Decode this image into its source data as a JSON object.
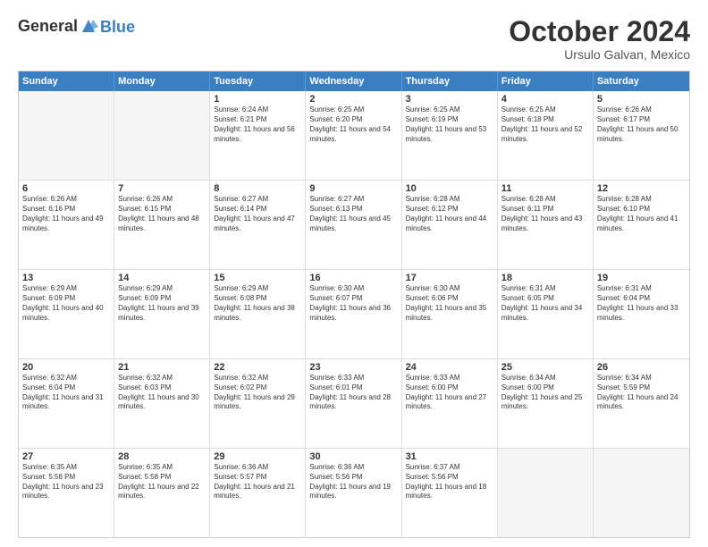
{
  "header": {
    "logo_line1": "General",
    "logo_line2": "Blue",
    "month": "October 2024",
    "location": "Ursulo Galvan, Mexico"
  },
  "weekdays": [
    "Sunday",
    "Monday",
    "Tuesday",
    "Wednesday",
    "Thursday",
    "Friday",
    "Saturday"
  ],
  "rows": [
    [
      {
        "day": "",
        "text": "",
        "empty": true
      },
      {
        "day": "",
        "text": "",
        "empty": true
      },
      {
        "day": "1",
        "text": "Sunrise: 6:24 AM\nSunset: 6:21 PM\nDaylight: 11 hours and 56 minutes.",
        "empty": false
      },
      {
        "day": "2",
        "text": "Sunrise: 6:25 AM\nSunset: 6:20 PM\nDaylight: 11 hours and 54 minutes.",
        "empty": false
      },
      {
        "day": "3",
        "text": "Sunrise: 6:25 AM\nSunset: 6:19 PM\nDaylight: 11 hours and 53 minutes.",
        "empty": false
      },
      {
        "day": "4",
        "text": "Sunrise: 6:25 AM\nSunset: 6:18 PM\nDaylight: 11 hours and 52 minutes.",
        "empty": false
      },
      {
        "day": "5",
        "text": "Sunrise: 6:26 AM\nSunset: 6:17 PM\nDaylight: 11 hours and 50 minutes.",
        "empty": false
      }
    ],
    [
      {
        "day": "6",
        "text": "Sunrise: 6:26 AM\nSunset: 6:16 PM\nDaylight: 11 hours and 49 minutes.",
        "empty": false
      },
      {
        "day": "7",
        "text": "Sunrise: 6:26 AM\nSunset: 6:15 PM\nDaylight: 11 hours and 48 minutes.",
        "empty": false
      },
      {
        "day": "8",
        "text": "Sunrise: 6:27 AM\nSunset: 6:14 PM\nDaylight: 11 hours and 47 minutes.",
        "empty": false
      },
      {
        "day": "9",
        "text": "Sunrise: 6:27 AM\nSunset: 6:13 PM\nDaylight: 11 hours and 45 minutes.",
        "empty": false
      },
      {
        "day": "10",
        "text": "Sunrise: 6:28 AM\nSunset: 6:12 PM\nDaylight: 11 hours and 44 minutes.",
        "empty": false
      },
      {
        "day": "11",
        "text": "Sunrise: 6:28 AM\nSunset: 6:11 PM\nDaylight: 11 hours and 43 minutes.",
        "empty": false
      },
      {
        "day": "12",
        "text": "Sunrise: 6:28 AM\nSunset: 6:10 PM\nDaylight: 11 hours and 41 minutes.",
        "empty": false
      }
    ],
    [
      {
        "day": "13",
        "text": "Sunrise: 6:29 AM\nSunset: 6:09 PM\nDaylight: 11 hours and 40 minutes.",
        "empty": false
      },
      {
        "day": "14",
        "text": "Sunrise: 6:29 AM\nSunset: 6:09 PM\nDaylight: 11 hours and 39 minutes.",
        "empty": false
      },
      {
        "day": "15",
        "text": "Sunrise: 6:29 AM\nSunset: 6:08 PM\nDaylight: 11 hours and 38 minutes.",
        "empty": false
      },
      {
        "day": "16",
        "text": "Sunrise: 6:30 AM\nSunset: 6:07 PM\nDaylight: 11 hours and 36 minutes.",
        "empty": false
      },
      {
        "day": "17",
        "text": "Sunrise: 6:30 AM\nSunset: 6:06 PM\nDaylight: 11 hours and 35 minutes.",
        "empty": false
      },
      {
        "day": "18",
        "text": "Sunrise: 6:31 AM\nSunset: 6:05 PM\nDaylight: 11 hours and 34 minutes.",
        "empty": false
      },
      {
        "day": "19",
        "text": "Sunrise: 6:31 AM\nSunset: 6:04 PM\nDaylight: 11 hours and 33 minutes.",
        "empty": false
      }
    ],
    [
      {
        "day": "20",
        "text": "Sunrise: 6:32 AM\nSunset: 6:04 PM\nDaylight: 11 hours and 31 minutes.",
        "empty": false
      },
      {
        "day": "21",
        "text": "Sunrise: 6:32 AM\nSunset: 6:03 PM\nDaylight: 11 hours and 30 minutes.",
        "empty": false
      },
      {
        "day": "22",
        "text": "Sunrise: 6:32 AM\nSunset: 6:02 PM\nDaylight: 11 hours and 29 minutes.",
        "empty": false
      },
      {
        "day": "23",
        "text": "Sunrise: 6:33 AM\nSunset: 6:01 PM\nDaylight: 11 hours and 28 minutes.",
        "empty": false
      },
      {
        "day": "24",
        "text": "Sunrise: 6:33 AM\nSunset: 6:00 PM\nDaylight: 11 hours and 27 minutes.",
        "empty": false
      },
      {
        "day": "25",
        "text": "Sunrise: 6:34 AM\nSunset: 6:00 PM\nDaylight: 11 hours and 25 minutes.",
        "empty": false
      },
      {
        "day": "26",
        "text": "Sunrise: 6:34 AM\nSunset: 5:59 PM\nDaylight: 11 hours and 24 minutes.",
        "empty": false
      }
    ],
    [
      {
        "day": "27",
        "text": "Sunrise: 6:35 AM\nSunset: 5:58 PM\nDaylight: 11 hours and 23 minutes.",
        "empty": false
      },
      {
        "day": "28",
        "text": "Sunrise: 6:35 AM\nSunset: 5:58 PM\nDaylight: 11 hours and 22 minutes.",
        "empty": false
      },
      {
        "day": "29",
        "text": "Sunrise: 6:36 AM\nSunset: 5:57 PM\nDaylight: 11 hours and 21 minutes.",
        "empty": false
      },
      {
        "day": "30",
        "text": "Sunrise: 6:36 AM\nSunset: 5:56 PM\nDaylight: 11 hours and 19 minutes.",
        "empty": false
      },
      {
        "day": "31",
        "text": "Sunrise: 6:37 AM\nSunset: 5:56 PM\nDaylight: 11 hours and 18 minutes.",
        "empty": false
      },
      {
        "day": "",
        "text": "",
        "empty": true
      },
      {
        "day": "",
        "text": "",
        "empty": true
      }
    ]
  ]
}
